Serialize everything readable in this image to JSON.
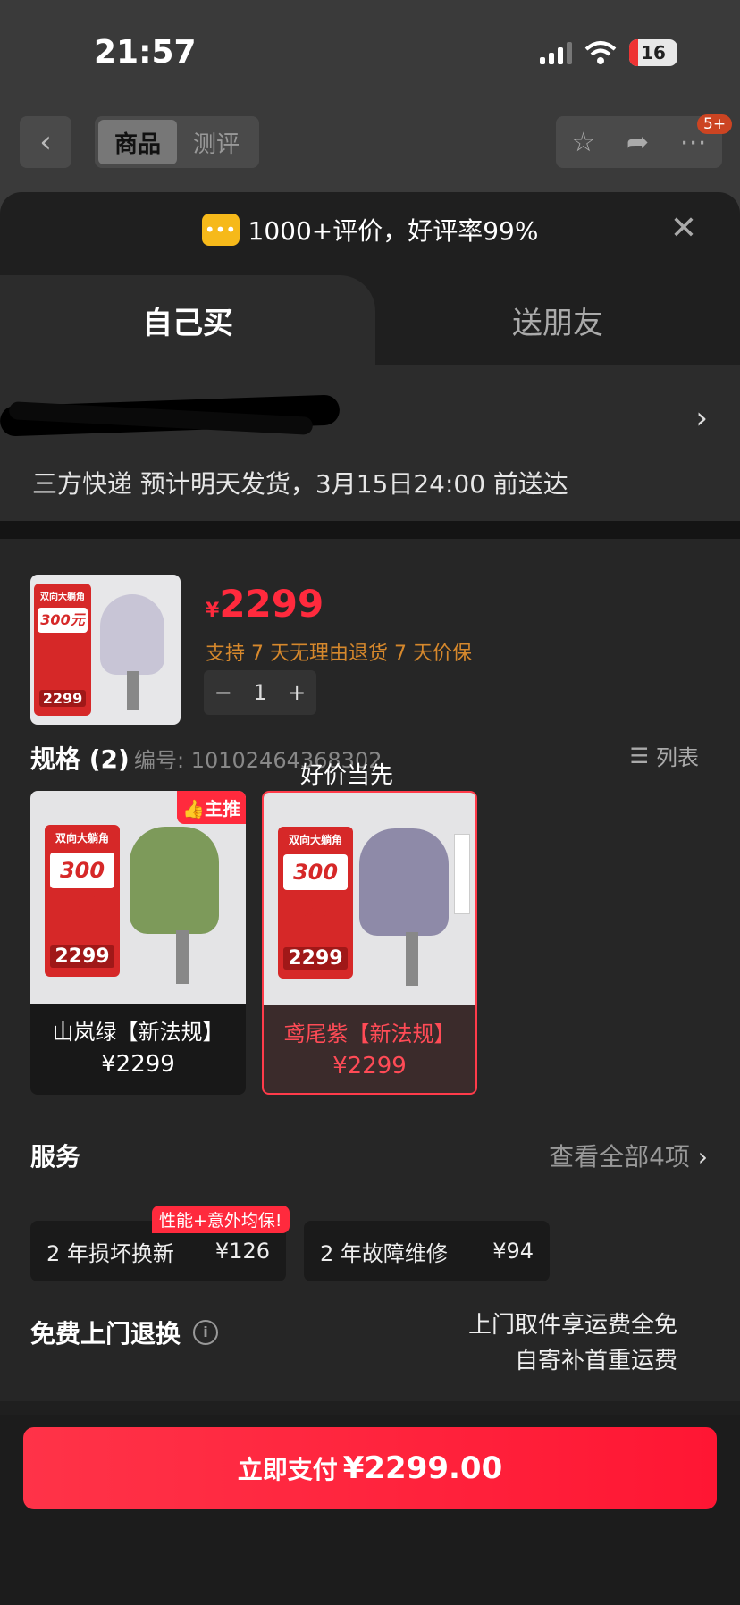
{
  "status_bar": {
    "time": "21:57",
    "battery": "16"
  },
  "nav": {
    "tabs": [
      {
        "label": "商品",
        "active": true
      },
      {
        "label": "测评",
        "active": false
      }
    ],
    "notification_badge": "5+"
  },
  "sheet": {
    "rating_text": "1000+评价，好评率99%",
    "buy_tabs": [
      {
        "label": "自己买",
        "active": true
      },
      {
        "label": "送朋友",
        "active": false
      }
    ],
    "delivery_text": "三方快递 预计明天发货，3月15日24:00 前送达",
    "product": {
      "price_symbol": "¥",
      "price": "2299",
      "guarantee": "支持 7 天无理由退货   7 天价保",
      "quantity": "1",
      "thumb_promo": {
        "title": "双向大躺角",
        "amount": "300元",
        "price": "2299"
      }
    },
    "spec": {
      "title": "规格 (2)",
      "code": "编号: 10102464368302",
      "tag": "好价当先",
      "view_toggle": "列表",
      "items": [
        {
          "name": "山岚绿【新法规】",
          "price": "¥2299",
          "badge": "主推",
          "selected": false
        },
        {
          "name": "鸢尾紫【新法规】",
          "price": "¥2299",
          "badge": "",
          "selected": true
        }
      ],
      "promo_title": "双向大躺角",
      "promo_amount": "300元",
      "promo_price": "2299"
    },
    "services": {
      "title": "服务",
      "view_all": "查看全部4项",
      "promo_tag": "性能+意外均保!",
      "items": [
        {
          "name": "2 年损坏换新",
          "price": "¥126"
        },
        {
          "name": "2 年故障维修",
          "price": "¥94"
        }
      ]
    },
    "free_return": {
      "title": "免费上门退换",
      "line1": "上门取件享运费全免",
      "line2": "自寄补首重运费"
    },
    "pay_button": {
      "label": "立即支付",
      "amount": "¥2299.00"
    }
  },
  "colors": {
    "accent": "#ff2a3d",
    "guarantee": "#d6882c"
  }
}
